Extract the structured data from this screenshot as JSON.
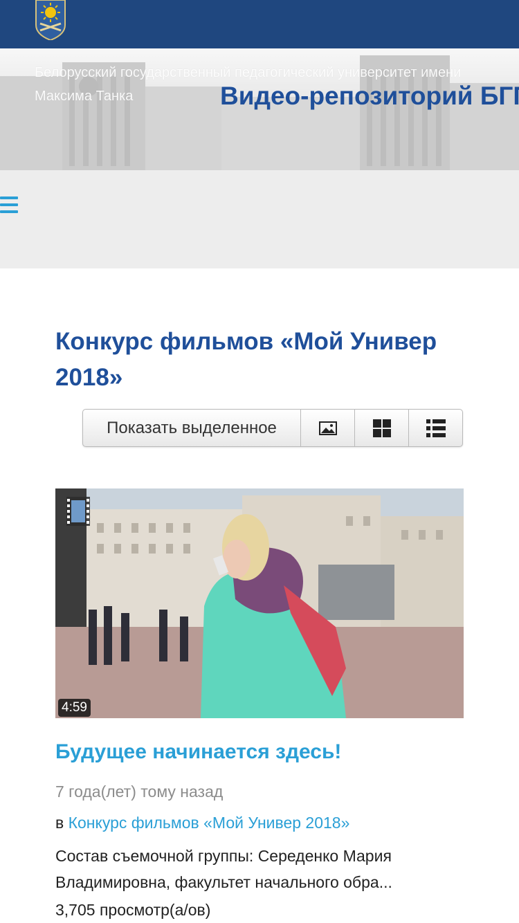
{
  "colors": {
    "topbar": "#1f477f",
    "title_blue": "#1f4f9a",
    "link_blue": "#2a9fd6",
    "nav_bg": "#ededed",
    "muted_text": "#8c8c8c"
  },
  "header": {
    "logo": "crest-icon",
    "university_name": "Белорусский государственный педагогический университет имени Максима Танка",
    "site_title": "Видео-репозиторий БГПУ"
  },
  "nav": {
    "menu_icon": "hamburger-icon"
  },
  "page": {
    "title": "Конкурс фильмов «Мой Универ 2018»"
  },
  "view_toolbar": {
    "show_selected_label": "Показать выделенное",
    "icons": [
      "image-view-icon",
      "grid-view-icon",
      "list-view-icon"
    ]
  },
  "videos": [
    {
      "title": "Будущее начинается здесь!",
      "duration": "4:59",
      "time_ago": "7 года(лет) тому назад",
      "in_prefix": "в",
      "category": "Конкурс фильмов «Мой Универ 2018»",
      "description": "Состав съемочной группы: Середенко Мария Владимировна, факультет начального обра...",
      "views": "3,705 просмотр(а/ов)",
      "thumbnail_icon": "film-strip-icon"
    }
  ]
}
